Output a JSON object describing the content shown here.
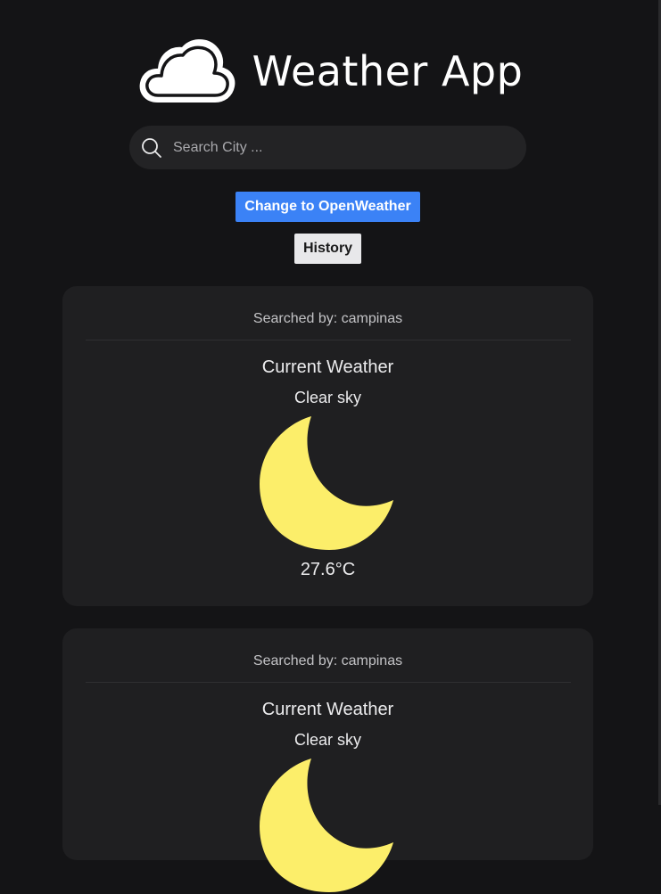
{
  "app": {
    "title": "Weather App"
  },
  "search": {
    "placeholder": "Search City ..."
  },
  "buttons": {
    "change_provider": "Change to OpenWeather",
    "history": "History"
  },
  "colors": {
    "primary_button": "#3b82f6",
    "moon": "#fcee6a",
    "card": "#1f1f21",
    "background": "#141416"
  },
  "cards": [
    {
      "searched_by": "Searched by: campinas",
      "heading": "Current Weather",
      "description": "Clear sky",
      "icon": "crescent-moon-icon",
      "temperature": "27.6°C"
    },
    {
      "searched_by": "Searched by: campinas",
      "heading": "Current Weather",
      "description": "Clear sky",
      "icon": "crescent-moon-icon"
    }
  ]
}
